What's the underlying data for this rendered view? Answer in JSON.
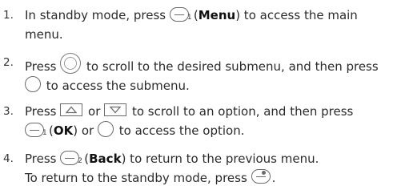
{
  "steps": [
    {
      "number": "1.",
      "line1_pre": "In standby mode, press",
      "line1_key_sub": "1",
      "line1_paren_open": "(",
      "line1_bold": "Menu",
      "line1_post": ") to access the main",
      "line2": "menu."
    },
    {
      "number": "2.",
      "line1_pre": "Press",
      "line1_post": "to scroll to the desired submenu, and then press",
      "line2_post": "to access the submenu."
    },
    {
      "number": "3.",
      "line1_pre": "Press",
      "line1_or": "or",
      "line1_post": "to scroll to an option, and then press",
      "line2_key_sub": "1",
      "line2_paren_open": "(",
      "line2_bold": "OK",
      "line2_mid": ") or",
      "line2_post": "to access the option."
    },
    {
      "number": "4.",
      "line1_pre": "Press",
      "line1_key_sub": "2",
      "line1_paren_open": "(",
      "line1_bold": "Back",
      "line1_post": ") to return to the previous menu.",
      "line2_pre": "To return to the standby mode, press",
      "line2_post": "."
    }
  ],
  "icons": {
    "left_softkey": "left-softkey-icon",
    "right_softkey": "right-softkey-icon",
    "navigation": "navigation-key-icon",
    "confirm": "confirm-key-icon",
    "up": "up-key-icon",
    "down": "down-key-icon",
    "end": "end-key-icon"
  },
  "colors": {
    "text": "#2b2b2b",
    "icon_stroke": "#6b6b6b"
  }
}
